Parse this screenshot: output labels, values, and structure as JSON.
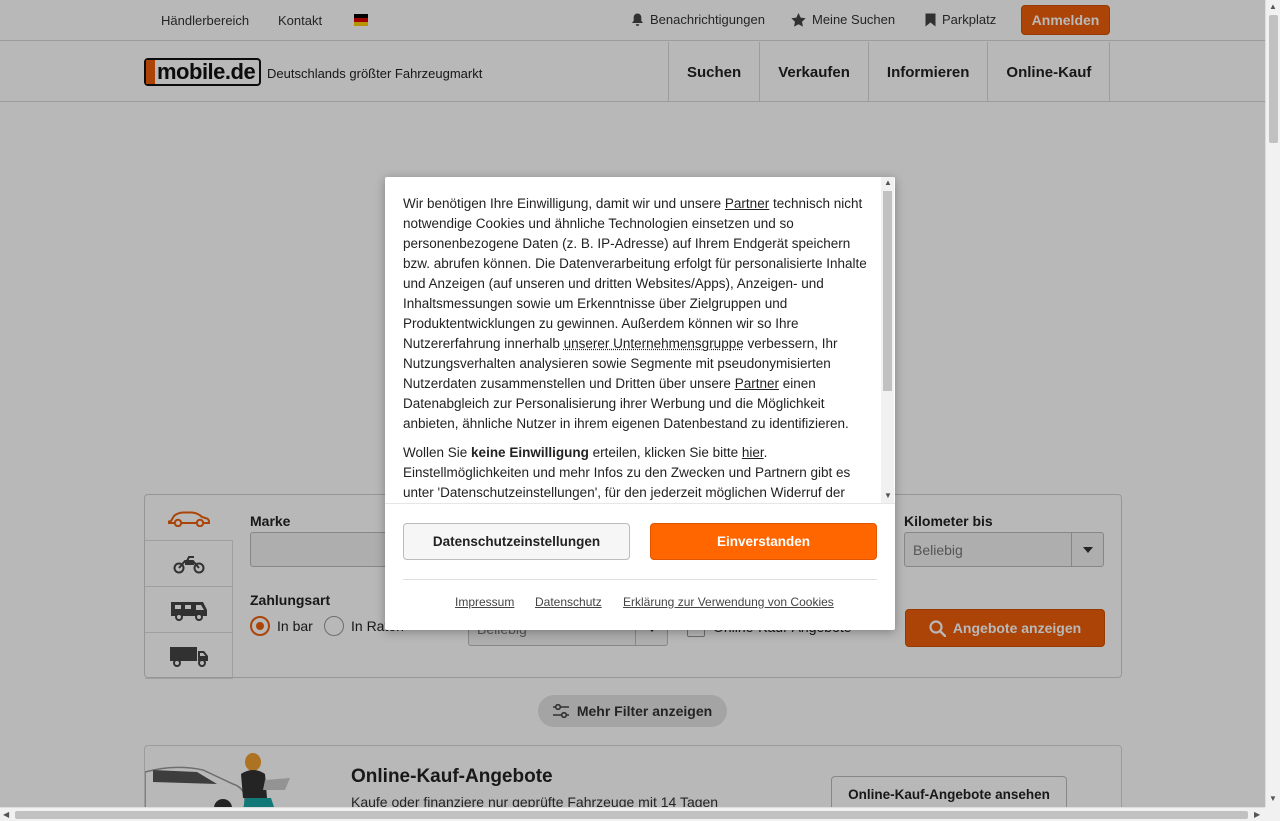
{
  "topbar": {
    "dealer": "Händlerbereich",
    "contact": "Kontakt",
    "language_icon": "germany-flag-icon",
    "notifications": "Benachrichtigungen",
    "my_searches": "Meine Suchen",
    "parking": "Parkplatz",
    "login": "Anmelden"
  },
  "header": {
    "logo": "mobile.de",
    "tagline": "Deutschlands größter Fahrzeugmarkt",
    "nav": [
      "Suchen",
      "Verkaufen",
      "Informieren",
      "Online-Kauf"
    ]
  },
  "search": {
    "make_label": "Marke",
    "km_label": "Kilometer bis",
    "km_value": "Beliebig",
    "payment_label": "Zahlungsart",
    "pay_cash": "In bar",
    "pay_installments": "In Raten",
    "price_value": "Beliebig",
    "online_only": "Online-Kauf-Angebote",
    "show_offers": "Angebote anzeigen",
    "vehicle_tabs": [
      "car-icon",
      "motorbike-icon",
      "camper-icon",
      "truck-icon"
    ]
  },
  "more_filters": "Mehr Filter anzeigen",
  "promo": {
    "title": "Online-Kauf-Angebote",
    "subtitle": "Kaufe oder finanziere nur geprüfte Fahrzeuge mit 14 Tagen",
    "button": "Online-Kauf-Angebote ansehen"
  },
  "consent": {
    "p1_a": "Wir benötigen Ihre Einwilligung, damit wir und unsere ",
    "p1_link1": "Partner",
    "p1_b": " technisch nicht notwendige Cookies und ähnliche Technologien einsetzen und so personenbezogene Daten (z. B. IP-Adresse) auf Ihrem Endgerät speichern bzw. abrufen können. Die Datenverarbeitung erfolgt für personalisierte Inhalte und Anzeigen (auf unseren und dritten Websites/Apps), Anzeigen- und Inhaltsmessungen sowie um Erkenntnisse über Zielgruppen und Produktentwicklungen zu gewinnen. Außerdem können wir so Ihre Nutzererfahrung innerhalb ",
    "p1_link2": "unserer Unternehmensgruppe",
    "p1_c": " verbessern, Ihr Nutzungsverhalten analysieren sowie Segmente mit pseudonymisierten Nutzerdaten zusammenstellen und Dritten über unsere ",
    "p1_link3": "Partner",
    "p1_d": " einen Datenabgleich zur Personalisierung ihrer Werbung und die Möglichkeit anbieten, ähnliche Nutzer in ihrem eigenen Datenbestand zu identifizieren.",
    "p2_a": "Wollen Sie ",
    "p2_bold": "keine Einwilligung",
    "p2_b": " erteilen, klicken Sie bitte ",
    "p2_link": "hier",
    "p2_c": ". Einstellmöglichkeiten und mehr Infos zu den Zwecken und Partnern gibt es unter 'Datenschutzeinstellungen', für den jederzeit möglichen Widerruf der",
    "btn_settings": "Datenschutzeinstellungen",
    "btn_accept": "Einverstanden",
    "link_imprint": "Impressum",
    "link_privacy": "Datenschutz",
    "link_cookies": "Erklärung zur Verwendung von Cookies"
  },
  "colors": {
    "accent": "#ef5f0a",
    "accept": "#ff6600"
  }
}
